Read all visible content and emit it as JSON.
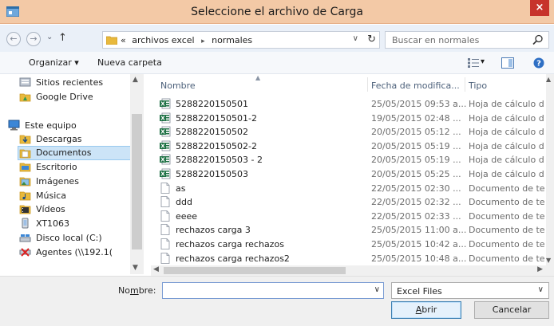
{
  "window": {
    "title": "Seleccione el archivo de Carga",
    "close_glyph": "×"
  },
  "address": {
    "back_glyph": "←",
    "forward_glyph": "→",
    "history_glyph": "⌄",
    "up_glyph": "↑",
    "crumbs": [
      "«",
      "archivos excel",
      "normales"
    ],
    "crumb_sep": "▸",
    "dropdown_glyph": "∨",
    "refresh_glyph": "↻",
    "search_placeholder": "Buscar en normales"
  },
  "toolbar": {
    "organize_label": "Organizar ▾",
    "new_folder_label": "Nueva carpeta",
    "view_glyph": "▾"
  },
  "nav": {
    "items": [
      {
        "label": "Sitios recientes",
        "icon": "recent-places-icon"
      },
      {
        "label": "Google Drive",
        "icon": "google-drive-icon"
      },
      {
        "label": "Este equipo",
        "icon": "computer-icon"
      },
      {
        "label": "Descargas",
        "icon": "downloads-icon"
      },
      {
        "label": "Documentos",
        "icon": "documents-icon",
        "selected": true
      },
      {
        "label": "Escritorio",
        "icon": "desktop-icon"
      },
      {
        "label": "Imágenes",
        "icon": "pictures-icon"
      },
      {
        "label": "Música",
        "icon": "music-icon"
      },
      {
        "label": "Vídeos",
        "icon": "videos-icon"
      },
      {
        "label": "XT1063",
        "icon": "device-icon"
      },
      {
        "label": "Disco local (C:)",
        "icon": "local-disk-icon"
      },
      {
        "label": "Agentes (\\\\192.1(",
        "icon": "network-drive-icon"
      }
    ]
  },
  "files": {
    "columns": {
      "name": "Nombre",
      "date": "Fecha de modifica...",
      "type": "Tipo"
    },
    "rows": [
      {
        "name": "5288220150501",
        "date": "25/05/2015 09:53 a...",
        "type": "Hoja de cálculo d",
        "kind": "excel"
      },
      {
        "name": "5288220150501-2",
        "date": "19/05/2015 02:48 ...",
        "type": "Hoja de cálculo d",
        "kind": "excel"
      },
      {
        "name": "5288220150502",
        "date": "20/05/2015 05:12 ...",
        "type": "Hoja de cálculo d",
        "kind": "excel"
      },
      {
        "name": "5288220150502-2",
        "date": "20/05/2015 05:19 ...",
        "type": "Hoja de cálculo d",
        "kind": "excel"
      },
      {
        "name": "5288220150503 - 2",
        "date": "20/05/2015 05:19 ...",
        "type": "Hoja de cálculo d",
        "kind": "excel"
      },
      {
        "name": "5288220150503",
        "date": "20/05/2015 05:25 ...",
        "type": "Hoja de cálculo d",
        "kind": "excel"
      },
      {
        "name": "as",
        "date": "22/05/2015 02:30 ...",
        "type": "Documento de te",
        "kind": "text"
      },
      {
        "name": "ddd",
        "date": "22/05/2015 02:32 ...",
        "type": "Documento de te",
        "kind": "text"
      },
      {
        "name": "eeee",
        "date": "22/05/2015 02:33 ...",
        "type": "Documento de te",
        "kind": "text"
      },
      {
        "name": "rechazos carga 3",
        "date": "25/05/2015 11:00 a...",
        "type": "Documento de te",
        "kind": "text"
      },
      {
        "name": "rechazos carga rechazos",
        "date": "25/05/2015 10:42 a...",
        "type": "Documento de te",
        "kind": "text"
      },
      {
        "name": "rechazos carga rechazos2",
        "date": "25/05/2015 10:48 a...",
        "type": "Documento de te",
        "kind": "text"
      }
    ]
  },
  "bottom": {
    "filename_label_pre": "No",
    "filename_label_u": "m",
    "filename_label_post": "bre:",
    "filename_value": "",
    "filter_value": "Excel Files",
    "open_u": "A",
    "open_rest": "brir",
    "cancel_label": "Cancelar"
  },
  "colors": {
    "titlebar": "#f3c9a6",
    "close": "#c7332b",
    "selection": "#cce4f7",
    "excel_green": "#1e7145"
  }
}
